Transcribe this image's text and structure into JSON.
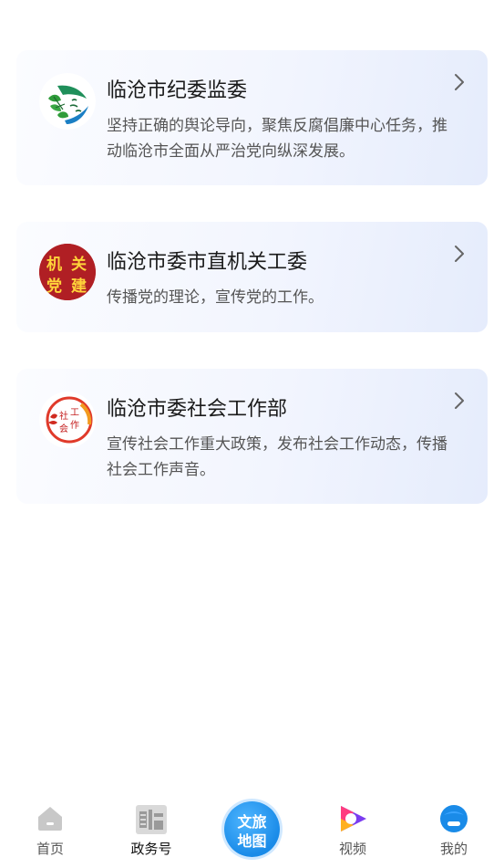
{
  "cards": [
    {
      "name": "临沧市纪委监委",
      "desc": "坚持正确的舆论导向，聚焦反腐倡廉中心任务，推动临沧市全面从严治党向纵深发展。",
      "logo_icon": "lincang-discipline-logo"
    },
    {
      "name": "临沧市委市直机关工委",
      "desc": "传播党的理论，宣传党的工作。",
      "logo_icon": "organ-party-building-logo",
      "logo_text": [
        "机",
        "关",
        "党",
        "建"
      ]
    },
    {
      "name": "临沧市委社会工作部",
      "desc": "宣传社会工作重大政策，发布社会工作动态，传播社会工作声音。",
      "logo_icon": "social-work-logo"
    }
  ],
  "tabbar": {
    "items": [
      {
        "label": "首页",
        "icon": "home-icon"
      },
      {
        "label": "政务号",
        "icon": "gov-account-icon",
        "active": true
      },
      {
        "label": "文旅\n地图",
        "icon": "culture-tourism-map-button"
      },
      {
        "label": "视频",
        "icon": "video-icon"
      },
      {
        "label": "我的",
        "icon": "profile-icon"
      }
    ],
    "center_line1": "文旅",
    "center_line2": "地图"
  },
  "colors": {
    "accent_blue": "#1a8be8",
    "center_button": "#2a9df4",
    "logo_red": "#b01f24",
    "logo_yellow": "#ffd43a"
  }
}
